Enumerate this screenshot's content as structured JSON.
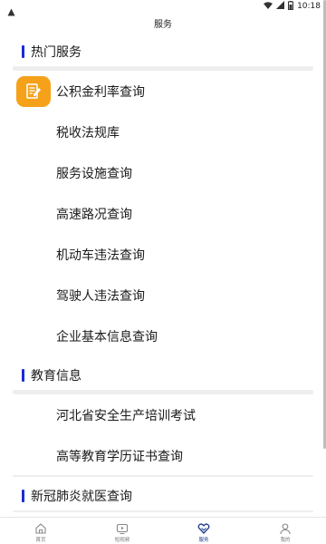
{
  "status_bar": {
    "time": "10:18"
  },
  "app": {
    "title": "服务"
  },
  "sections": {
    "hot": {
      "title": "热门服务",
      "items": [
        {
          "label": "公积金利率查询",
          "icon": "document-edit-icon"
        },
        {
          "label": "税收法规库"
        },
        {
          "label": "服务设施查询"
        },
        {
          "label": "高速路况查询"
        },
        {
          "label": "机动车违法查询"
        },
        {
          "label": "驾驶人违法查询"
        },
        {
          "label": "企业基本信息查询"
        }
      ]
    },
    "education": {
      "title": "教育信息",
      "items": [
        {
          "label": "河北省安全生产培训考试"
        },
        {
          "label": "高等教育学历证书查询"
        }
      ]
    },
    "covid": {
      "title": "新冠肺炎就医查询"
    }
  },
  "bottom_nav": {
    "items": [
      {
        "label": "首页",
        "icon": "home-icon"
      },
      {
        "label": "短视频",
        "icon": "video-icon"
      },
      {
        "label": "服务",
        "icon": "heart-hands-icon",
        "active": true
      },
      {
        "label": "我的",
        "icon": "profile-icon"
      }
    ]
  },
  "colors": {
    "accent_bar": "#1b2ad8",
    "orange_icon": "#f5a11a",
    "nav_active": "#1b3a8c"
  }
}
